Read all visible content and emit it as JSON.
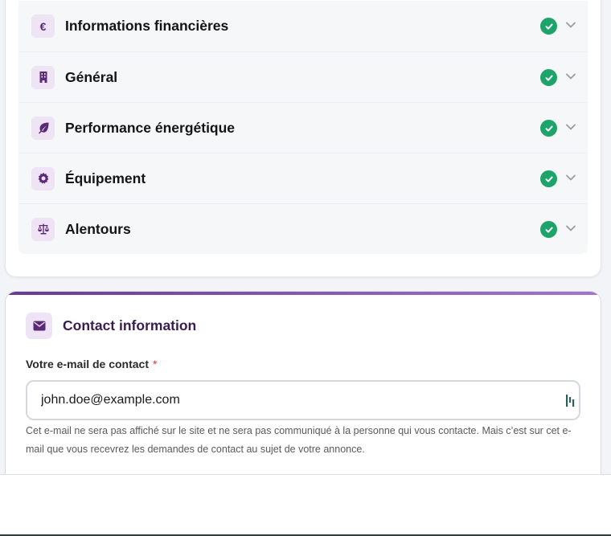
{
  "accordion": {
    "items": [
      {
        "label": "Informations financières",
        "icon": "euro-icon",
        "status": "complete"
      },
      {
        "label": "Général",
        "icon": "building-icon",
        "status": "complete"
      },
      {
        "label": "Performance énergétique",
        "icon": "leaf-icon",
        "status": "complete"
      },
      {
        "label": "Équipement",
        "icon": "gear-icon",
        "status": "complete"
      },
      {
        "label": "Alentours",
        "icon": "scale-icon",
        "status": "complete"
      }
    ],
    "euro_symbol": "€"
  },
  "contact": {
    "title": "Contact information",
    "email_label": "Votre e-mail de contact",
    "required_mark": "*",
    "email_value": "john.doe@example.com",
    "help_text": "Cet e-mail ne sera pas affiché sur le site et ne sera pas communiqué à la personne qui vous contacte. Mais c’est sur cet e-mail que vous recevrez les demandes de contact au sujet de votre annonce."
  },
  "colors": {
    "accent": "#5b2a76",
    "icon_bg": "#efe4f5",
    "check_green": "#1da46a",
    "required_red": "#d43b3b"
  }
}
